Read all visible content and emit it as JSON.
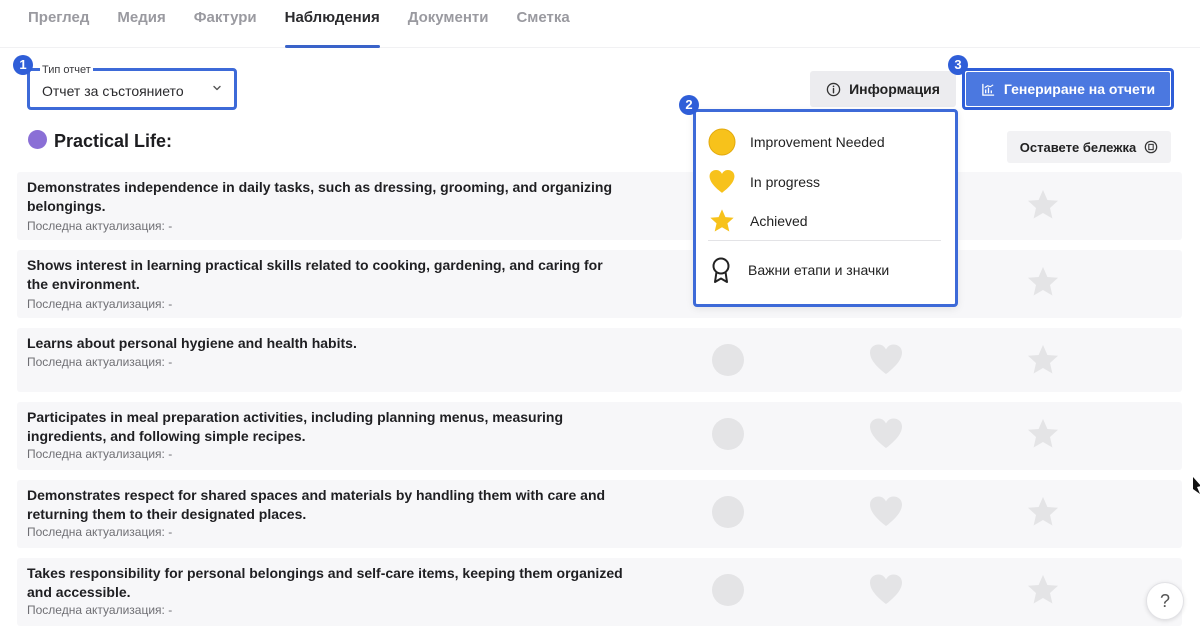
{
  "tabs": [
    {
      "label": "Преглед",
      "active": false
    },
    {
      "label": "Медия",
      "active": false
    },
    {
      "label": "Фактури",
      "active": false
    },
    {
      "label": "Наблюдения",
      "active": true
    },
    {
      "label": "Документи",
      "active": false
    },
    {
      "label": "Сметка",
      "active": false
    }
  ],
  "badges": [
    "1",
    "2",
    "3"
  ],
  "report_type": {
    "label": "Тип отчет",
    "value": "Отчет за състоянието"
  },
  "toolbar": {
    "info_label": "Информация",
    "generate_label": "Генериране на отчети"
  },
  "section": {
    "title": "Practical Life:",
    "dot_color": "#8a6fd6",
    "note_label": "Оставете бележка"
  },
  "legend": {
    "items": [
      {
        "label": "Improvement Needed",
        "icon": "yellow-circle-icon"
      },
      {
        "label": "In progress",
        "icon": "yellow-heart-icon"
      },
      {
        "label": "Achieved",
        "icon": "star-icon"
      }
    ],
    "milestones_label": "Важни етапи и значки"
  },
  "rows": [
    {
      "title": "Demonstrates independence in daily tasks, such as dressing, grooming, and organizing belongings.",
      "updated": "Последна актуализация: -"
    },
    {
      "title": "Shows interest in learning practical skills related to cooking, gardening, and caring for the environment.",
      "updated": "Последна актуализация: -"
    },
    {
      "title": "Learns about personal hygiene and health habits.",
      "updated": "Последна актуализация: -"
    },
    {
      "title": "Participates in meal preparation activities, including planning menus, measuring ingredients, and following simple recipes.",
      "updated": "Последна актуализация: -"
    },
    {
      "title": "Demonstrates respect for shared spaces and materials by handling them with care and returning them to their designated places.",
      "updated": "Последна актуализация: -"
    },
    {
      "title": "Takes responsibility for personal belongings and self-care items, keeping them organized and accessible.",
      "updated": "Последна актуализация: -"
    }
  ],
  "help_label": "?",
  "colors": {
    "accent": "#2f5ed8",
    "generate_button": "#4b78e0",
    "legend_yellow": "#f7c21b",
    "rating_gray": "#e4e4e6"
  }
}
